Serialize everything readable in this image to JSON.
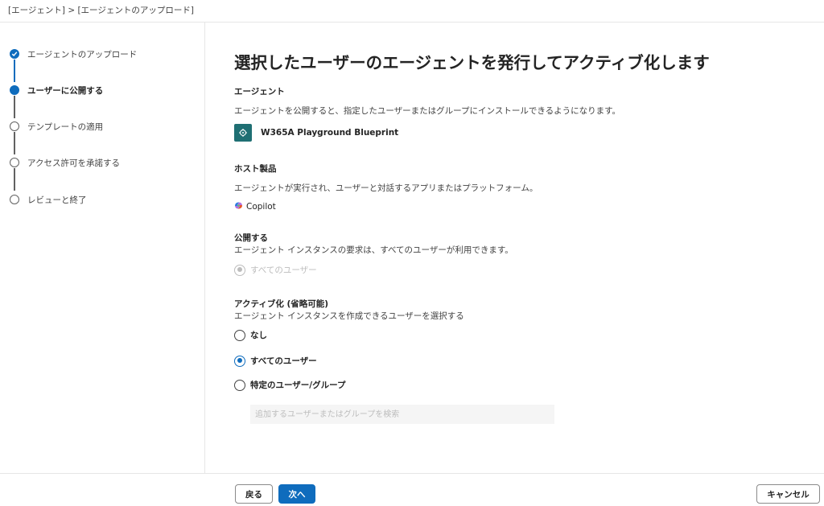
{
  "breadcrumb": "[エージェント] > [エージェントのアップロード]",
  "steps": [
    {
      "label": "エージェントのアップロード",
      "state": "done"
    },
    {
      "label": "ユーザーに公開する",
      "state": "current"
    },
    {
      "label": "テンプレートの適用",
      "state": "pending"
    },
    {
      "label": "アクセス許可を承諾する",
      "state": "pending"
    },
    {
      "label": "レビューと終了",
      "state": "pending"
    }
  ],
  "main": {
    "title": "選択したユーザーのエージェントを発行してアクティブ化します",
    "agent_section": {
      "heading": "エージェント",
      "description": "エージェントを公開すると、指定したユーザーまたはグループにインストールできるようになります。",
      "agent_name": "W365A Playground Blueprint"
    },
    "host_section": {
      "heading": "ホスト製品",
      "description": "エージェントが実行され、ユーザーと対話するアプリまたはプラットフォーム。",
      "product_name": "Copilot"
    },
    "publish_section": {
      "heading": "公開する",
      "description": "エージェント インスタンスの要求は、すべてのユーザーが利用できます。",
      "option_label": "すべてのユーザー"
    },
    "activate_section": {
      "heading": "アクティブ化 (省略可能)",
      "description": "エージェント インスタンスを作成できるユーザーを選択する",
      "options": [
        {
          "label": "なし",
          "selected": false
        },
        {
          "label": "すべてのユーザー",
          "selected": true
        },
        {
          "label": "特定のユーザー/グループ",
          "selected": false
        }
      ],
      "search_placeholder": "追加するユーザーまたはグループを検索"
    }
  },
  "footer": {
    "back_label": "戻る",
    "next_label": "次へ",
    "cancel_label": "キャンセル"
  },
  "colors": {
    "accent": "#0f6cbd",
    "agent_icon_bg": "#1f6f73"
  }
}
